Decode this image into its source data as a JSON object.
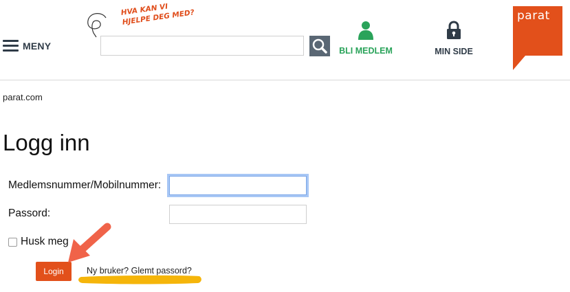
{
  "header": {
    "menu_label": "MENY",
    "help_text_line1": "HVA KAN VI",
    "help_text_line2": "HJELPE DEG MED?",
    "search": {
      "value": "",
      "placeholder": ""
    },
    "join_label": "BLI MEDLEM",
    "mypage_label": "MIN SIDE",
    "logo_text": "parat"
  },
  "breadcrumb": "parat.com",
  "page_title": "Logg inn",
  "form": {
    "member_label": "Medlemsnummer/Mobilnummer:",
    "member_value": "",
    "password_label": "Passord:",
    "password_value": "",
    "remember_label": "Husk meg",
    "remember_checked": false,
    "login_button": "Login",
    "new_user_link": "Ny bruker?",
    "forgot_link": "Glemt passord?"
  },
  "colors": {
    "brand_orange": "#e2501b",
    "join_green": "#2aa35a",
    "dark_slate": "#2f3b47",
    "focus_blue": "#a8c7f5",
    "annotation_red": "#f06349",
    "highlight_yellow": "#f5b50a"
  },
  "icons": {
    "menu": "hamburger-icon",
    "search": "magnifier-icon",
    "join": "person-icon",
    "mypage": "padlock-icon",
    "annotation": "arrow-annotation"
  }
}
